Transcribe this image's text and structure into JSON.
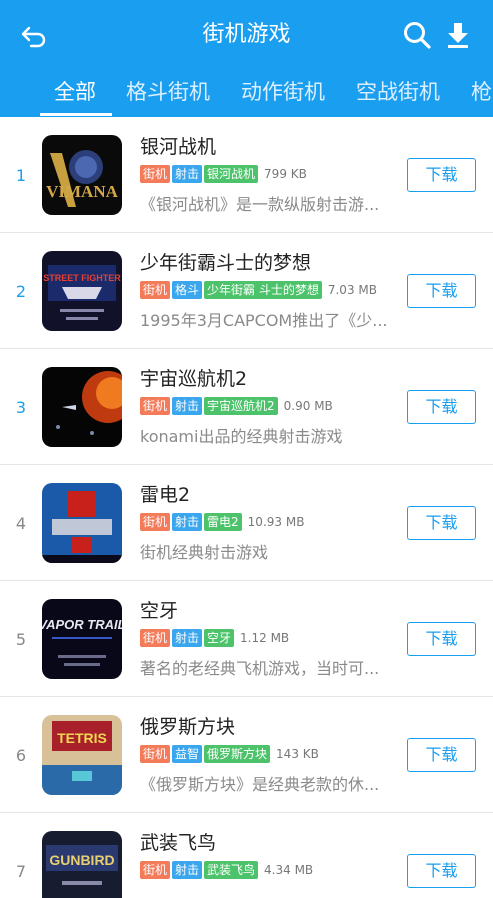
{
  "header": {
    "title": "街机游戏",
    "back_icon": "back-arrow-icon",
    "search_icon": "search-icon",
    "download_icon": "download-icon",
    "bg_color": "#1a9ef0"
  },
  "tabs": [
    {
      "label": "全部",
      "active": true
    },
    {
      "label": "格斗街机",
      "active": false
    },
    {
      "label": "动作街机",
      "active": false
    },
    {
      "label": "空战街机",
      "active": false
    },
    {
      "label": "枪",
      "active": false
    }
  ],
  "games": [
    {
      "rank": "1",
      "name": "银河战机",
      "category": "街机",
      "genre": "射击",
      "keyword": "银河战机",
      "size": "799 KB",
      "desc": "《银河战机》是一款纵版射击游...",
      "button": "下载"
    },
    {
      "rank": "2",
      "name": "少年街霸斗士的梦想",
      "category": "街机",
      "genre": "格斗",
      "keyword": "少年街霸 斗士的梦想",
      "size": "7.03 MB",
      "desc": "1995年3月CAPCOM推出了《少...",
      "button": "下载"
    },
    {
      "rank": "3",
      "name": "宇宙巡航机2",
      "category": "街机",
      "genre": "射击",
      "keyword": "宇宙巡航机2",
      "size": "0.90 MB",
      "desc": "konami出品的经典射击游戏",
      "button": "下载"
    },
    {
      "rank": "4",
      "name": "雷电2",
      "category": "街机",
      "genre": "射击",
      "keyword": "雷电2",
      "size": "10.93 MB",
      "desc": "街机经典射击游戏",
      "button": "下载"
    },
    {
      "rank": "5",
      "name": "空牙",
      "category": "街机",
      "genre": "射击",
      "keyword": "空牙",
      "size": "1.12 MB",
      "desc": "著名的老经典飞机游戏，当时可...",
      "button": "下载"
    },
    {
      "rank": "6",
      "name": "俄罗斯方块",
      "category": "街机",
      "genre": "益智",
      "keyword": "俄罗斯方块",
      "size": "143 KB",
      "desc": "《俄罗斯方块》是经典老款的休...",
      "button": "下载"
    },
    {
      "rank": "7",
      "name": "武装飞鸟",
      "category": "街机",
      "genre": "射击",
      "keyword": "武装飞鸟",
      "size": "4.34 MB",
      "desc": "",
      "button": "下载"
    }
  ],
  "thumbnails": [
    {
      "text": "VIMANA",
      "icon": "vimana-cover-icon"
    },
    {
      "text": "STREET FIGHTER",
      "icon": "street-fighter-cover-icon"
    },
    {
      "text": "",
      "icon": "gradius-cover-icon"
    },
    {
      "text": "",
      "icon": "raiden-cover-icon"
    },
    {
      "text": "VAPOR TRAIL",
      "icon": "vapor-trail-cover-icon"
    },
    {
      "text": "TETRIS",
      "icon": "tetris-cover-icon"
    },
    {
      "text": "GUNBIRD",
      "icon": "gunbird-cover-icon"
    }
  ]
}
